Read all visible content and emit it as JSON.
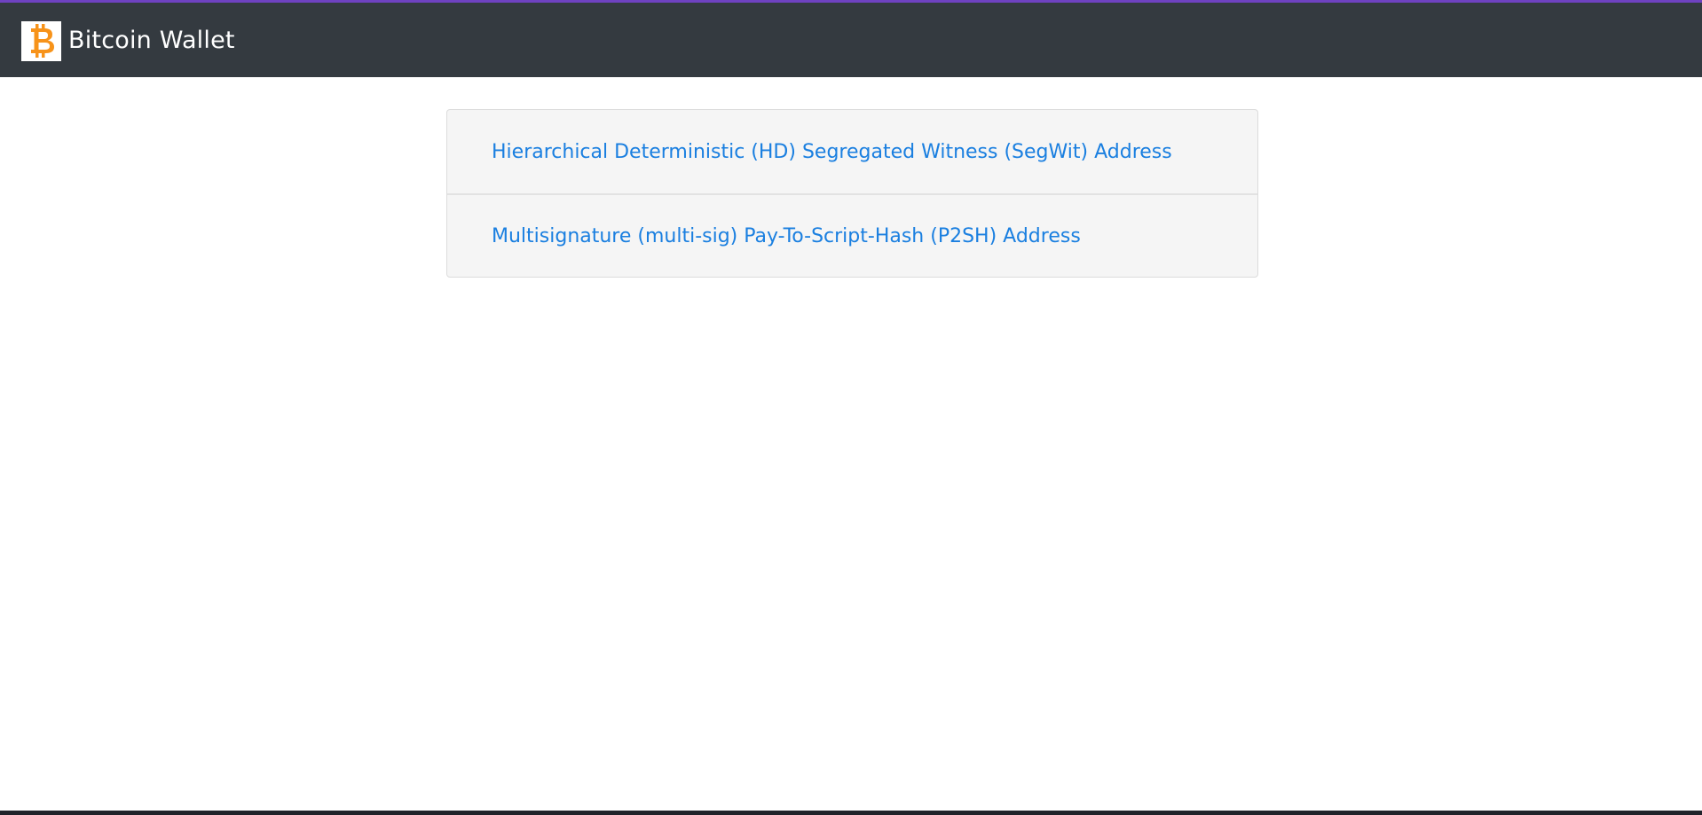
{
  "navbar": {
    "brand_title": "Bitcoin Wallet",
    "logo_icon": "bitcoin-logo-icon",
    "bar_color": "#343a40",
    "accent_color": "#6f42c1",
    "logo_color": "#f7931a"
  },
  "address_types": {
    "items": [
      {
        "label": "Hierarchical Deterministic (HD) Segregated Witness (SegWit) Address"
      },
      {
        "label": "Multisignature (multi-sig) Pay-To-Script-Hash (P2SH) Address"
      }
    ],
    "link_color": "#1a7fe0"
  }
}
